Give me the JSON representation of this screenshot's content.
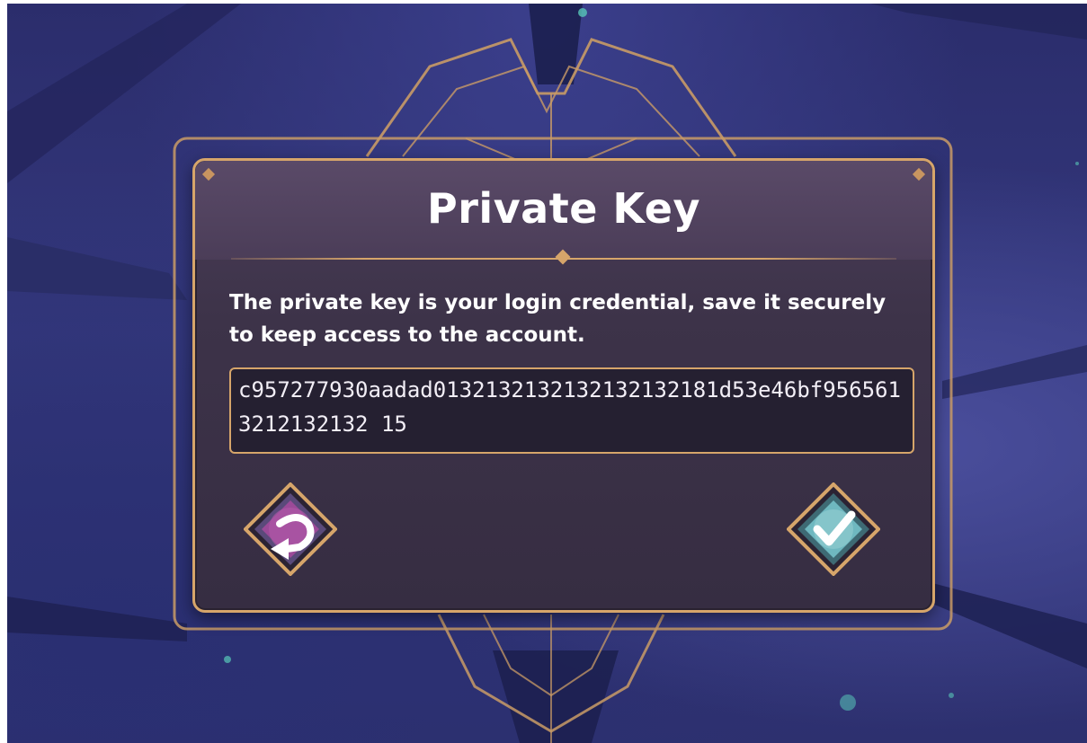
{
  "dialog": {
    "title": "Private Key",
    "description": "The private key is your login credential, save it securely to keep access to the account.",
    "private_key": "c957277930aadad01321321321321321321­81d53e46bf9565613212132132 15"
  },
  "buttons": {
    "back_icon": "return-arrow-icon",
    "confirm_icon": "checkmark-icon"
  },
  "colors": {
    "gold_border": "#d6a56a",
    "panel": "#3d3349",
    "back_button": "#a04a9a",
    "confirm_button": "#6fb8c0"
  }
}
